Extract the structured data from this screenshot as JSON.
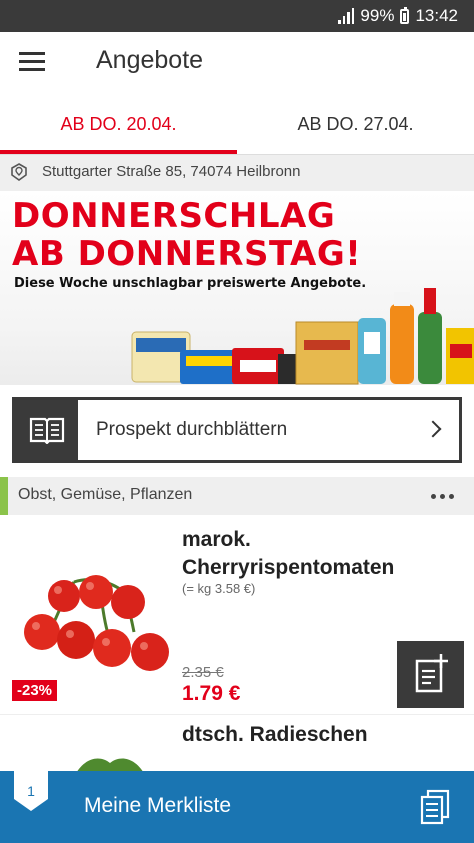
{
  "status_bar": {
    "battery": "99%",
    "time": "13:42"
  },
  "app_bar": {
    "title": "Angebote"
  },
  "tabs": [
    {
      "label": "AB DO. 20.04.",
      "active": true
    },
    {
      "label": "AB DO. 27.04.",
      "active": false
    }
  ],
  "store": {
    "address": "Stuttgarter Straße 85, 74074 Heilbronn"
  },
  "banner": {
    "line1": "DONNERSCHLAG",
    "line2": "AB DONNERSTAG!",
    "subtitle": "Diese Woche unschlagbar preiswerte Angebote."
  },
  "prospekt": {
    "label": "Prospekt durchblättern"
  },
  "category": {
    "label": "Obst, Gemüse, Pflanzen"
  },
  "products": [
    {
      "title_line1": "marok.",
      "title_line2": "Cherryrispentomaten",
      "unit_price": "(= kg 3.58 €)",
      "old_price": "2.35 €",
      "price": "1.79 €",
      "discount": "-23%"
    },
    {
      "title_line1": "dtsch. Radieschen"
    }
  ],
  "merkliste": {
    "count": "1",
    "label": "Meine Merkliste"
  },
  "colors": {
    "accent_red": "#e2001a",
    "bar_dark": "#3a3a3a",
    "merkliste_blue": "#1a75b2",
    "category_green": "#8bc34a"
  }
}
